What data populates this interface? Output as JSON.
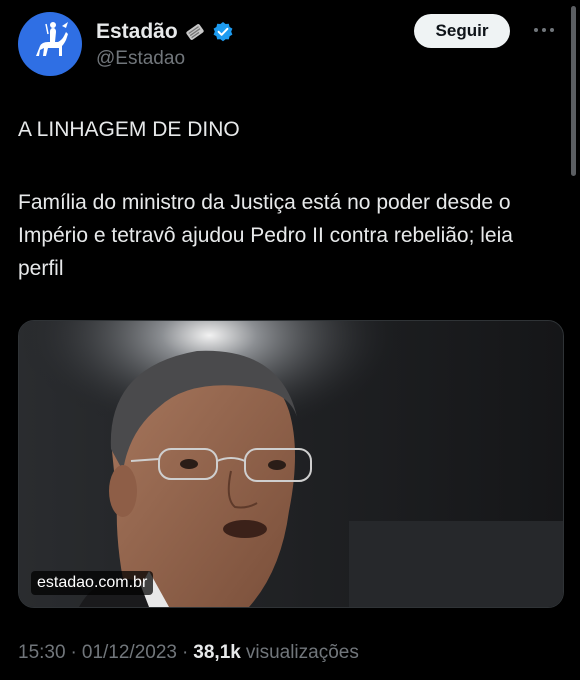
{
  "account": {
    "display_name": "Estadão",
    "handle": "@Estadao",
    "verified": true,
    "avatar_color": "#2f6fe4"
  },
  "actions": {
    "follow_label": "Seguir"
  },
  "tweet": {
    "headline": "A LINHAGEM DE DINO",
    "body": "Família do ministro da Justiça está no poder desde o Império e tetravô ajudou Pedro II contra rebelião; leia perfil",
    "media_domain": "estadao.com.br"
  },
  "meta": {
    "time": "15:30",
    "separator": "·",
    "date": "01/12/2023",
    "views_count": "38,1k",
    "views_label": "visualizações"
  },
  "icons": [
    "newspaper-icon",
    "verified-icon",
    "more-icon",
    "horseman-logo-icon"
  ],
  "colors": {
    "background": "#000000",
    "text": "#e7e9ea",
    "secondary": "#71767b",
    "verified": "#1d9bf0"
  }
}
